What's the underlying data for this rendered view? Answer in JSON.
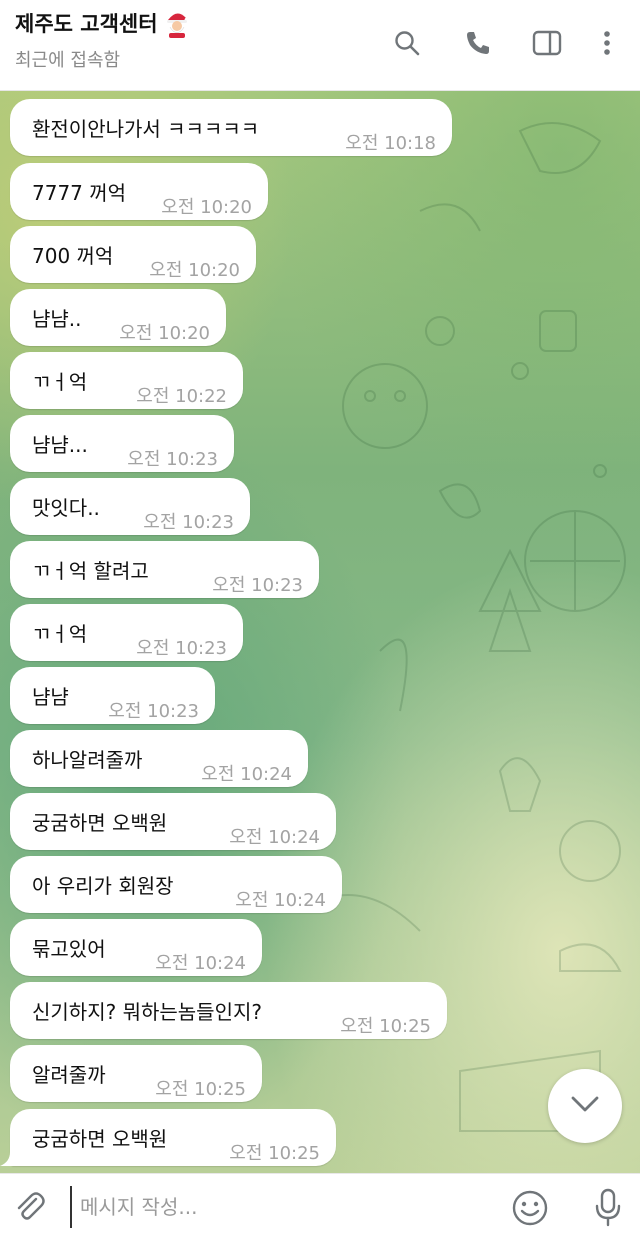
{
  "header": {
    "title": "제주도 고객센터",
    "subtitle": "최근에 접속함",
    "icons": [
      "santa-emoji",
      "search-icon",
      "phone-icon",
      "sidebar-icon",
      "more-vertical-icon"
    ]
  },
  "messages": [
    {
      "text": "환전이안나가서 ㅋㅋㅋㅋㅋ",
      "time": "오전 10:18"
    },
    {
      "text": "7777 꺼억",
      "time": "오전 10:20"
    },
    {
      "text": "700 꺼억",
      "time": "오전 10:20"
    },
    {
      "text": "냠냠..",
      "time": "오전 10:20"
    },
    {
      "text": "ㄲㅓ억",
      "time": "오전 10:22"
    },
    {
      "text": "냠냠...",
      "time": "오전 10:23"
    },
    {
      "text": "맛잇다..",
      "time": "오전 10:23"
    },
    {
      "text": "ㄲㅓ억 할려고",
      "time": "오전 10:23"
    },
    {
      "text": "ㄲㅓ억",
      "time": "오전 10:23"
    },
    {
      "text": "냠냠",
      "time": "오전 10:23"
    },
    {
      "text": "하나알려줄까",
      "time": "오전 10:24"
    },
    {
      "text": "궁굼하면 오백원",
      "time": "오전 10:24"
    },
    {
      "text": "아 우리가 회원장",
      "time": "오전 10:24"
    },
    {
      "text": "묶고있어",
      "time": "오전 10:24"
    },
    {
      "text": "신기하지? 뭐하는놈들인지?",
      "time": "오전 10:25"
    },
    {
      "text": "알려줄까",
      "time": "오전 10:25"
    },
    {
      "text": "궁굼하면 오백원",
      "time": "오전 10:25"
    }
  ],
  "composer": {
    "placeholder": "메시지 작성..."
  },
  "colors": {
    "bubble": "#ffffff",
    "time": "#a3a3a3",
    "icon": "#707579"
  }
}
